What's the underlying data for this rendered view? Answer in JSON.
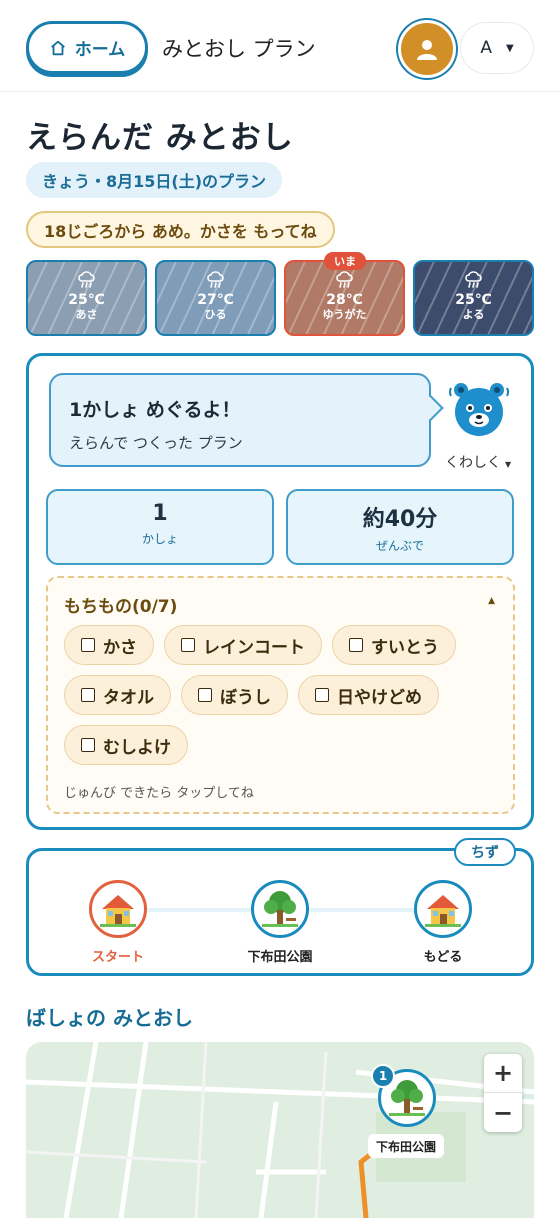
{
  "header": {
    "home_label": "ホーム",
    "app_title": "みとおし プラン",
    "font_size_label": "A"
  },
  "page": {
    "title": "えらんだ みとおし",
    "plan_date": "きょう・8月15日(土)のプラン",
    "weather_alert": "18じごろから あめ。かさを もってね"
  },
  "weather": {
    "now_badge": "いま",
    "slots": [
      {
        "label": "あさ",
        "temp": "25℃",
        "icon": "rain-cloud-icon"
      },
      {
        "label": "ひる",
        "temp": "27℃",
        "icon": "rain-cloud-icon"
      },
      {
        "label": "ゆうがた",
        "temp": "28℃",
        "icon": "rain-cloud-icon"
      },
      {
        "label": "よる",
        "temp": "25℃",
        "icon": "rain-cloud-icon"
      }
    ]
  },
  "summary": {
    "bubble_title": "1かしょ めぐるよ！",
    "bubble_sub": "えらんで つくった プラン",
    "details_label": "くわしく",
    "stats": [
      {
        "value": "1",
        "label": "かしょ"
      },
      {
        "value": "約40分",
        "label": "ぜんぶで"
      }
    ]
  },
  "belongings": {
    "title": "もちもの(0/7)",
    "items": [
      "かさ",
      "レインコート",
      "すいとう",
      "タオル",
      "ぼうし",
      "日やけどめ",
      "むしよけ"
    ],
    "hint": "じゅんび できたら タップしてね"
  },
  "route": {
    "map_tag": "ちず",
    "stops": [
      {
        "label": "スタート",
        "icon": "house-icon"
      },
      {
        "label": "下布田公園",
        "icon": "tree-icon"
      },
      {
        "label": "もどる",
        "icon": "house-icon"
      }
    ]
  },
  "map_section": {
    "title": "ばしょの みとおし",
    "pin_number": "1",
    "pin_label": "下布田公園",
    "zoom_in": "+",
    "zoom_out": "−"
  },
  "colors": {
    "primary": "#1a8bbd",
    "accent": "#e2613e",
    "alert_bg": "#fff6e2"
  }
}
